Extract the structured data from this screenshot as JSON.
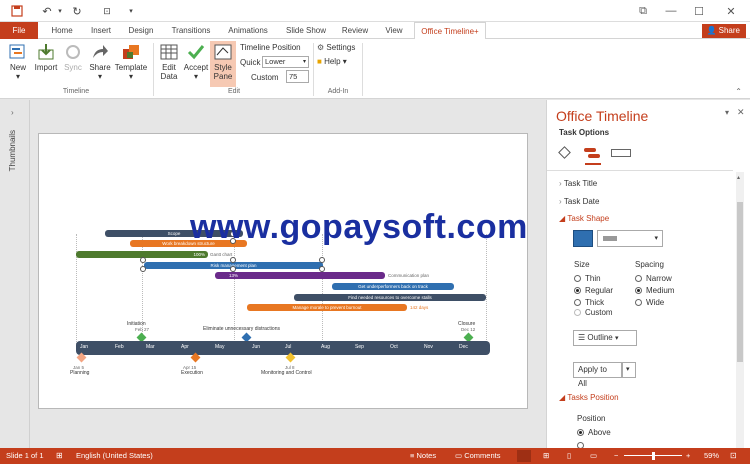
{
  "titlebar": {
    "restore": "⧉",
    "minimize": "—",
    "maximize": "☐",
    "close": "✕"
  },
  "tabs": [
    "File",
    "Home",
    "Insert",
    "Design",
    "Transitions",
    "Animations",
    "Slide Show",
    "Review",
    "View",
    "Office Timeline+"
  ],
  "share_label": "Share",
  "ribbon": {
    "timeline_buttons": [
      "New",
      "Import",
      "Sync",
      "Share",
      "Template"
    ],
    "timeline_group": "Timeline",
    "edit_buttons": [
      "Edit Data",
      "Accept",
      "Style Pane"
    ],
    "timeline_position": "Timeline Position",
    "quick_label": "Quick",
    "quick_value": "Lower",
    "custom_label": "Custom",
    "custom_value": "75",
    "edit_group": "Edit",
    "settings": "Settings",
    "help": "Help",
    "addin_group": "Add-In"
  },
  "rail": {
    "label": "Thumbnails"
  },
  "watermark": "www.gopaysoft.com",
  "timeline": {
    "months": [
      "Jan",
      "Feb",
      "Mar",
      "Apr",
      "May",
      "Jun",
      "Jul",
      "Aug",
      "Sep",
      "Oct",
      "Nov",
      "Dec"
    ],
    "bars": [
      {
        "text": "Scope",
        "color": "#3e4f66"
      },
      {
        "text": "Work breakdown structure",
        "color": "#e87722"
      },
      {
        "text": "Gantt chart",
        "color": "#4e7a2e"
      },
      {
        "text": "Risk management plan",
        "color": "#2f6fb0"
      },
      {
        "text": "",
        "color": "#6a2a8a"
      },
      {
        "text": "Get underperformers back on track",
        "color": "#2f6fb0"
      },
      {
        "text": "Find needed resources to overcome stalls",
        "color": "#3e4f66"
      },
      {
        "text": "Manage morale to prevent burnout",
        "color": "#e87722"
      }
    ],
    "bar_side_labels": {
      "gantt": "Gantt chart",
      "risk_pct": "13%",
      "comm": "Communication plan",
      "morale_days": "142 days",
      "gantt_pct": "100%"
    },
    "above": [
      {
        "name": "Initiation",
        "date": "Feb 27",
        "color": "#4caf50"
      },
      {
        "name": "Eliminate unnecessary distractions",
        "date": "",
        "color": "#2f6fb0"
      },
      {
        "name": "Closure",
        "date": "Dec 12",
        "color": "#4caf50"
      }
    ],
    "below": [
      {
        "name": "Planning",
        "date": "Jan 5",
        "color": "#f4a582"
      },
      {
        "name": "Execution",
        "date": "Apr 15",
        "color": "#e87722"
      },
      {
        "name": "Monitoring and Control",
        "date": "Jul 8",
        "color": "#f2c12e"
      }
    ]
  },
  "pane": {
    "title": "Office Timeline",
    "subtitle": "Task Options",
    "task_title": "Task Title",
    "task_date": "Task Date",
    "task_shape": "Task Shape",
    "size_label": "Size",
    "size_options": [
      "Thin",
      "Regular",
      "Thick",
      "Custom"
    ],
    "spacing_label": "Spacing",
    "spacing_options": [
      "Narrow",
      "Medium",
      "Wide"
    ],
    "outline": "Outline",
    "apply_all": "Apply to All",
    "tasks_position": "Tasks Position",
    "position_label": "Position",
    "position_option": "Above"
  },
  "status": {
    "slide": "Slide 1 of 1",
    "lang": "English (United States)",
    "notes": "Notes",
    "comments": "Comments",
    "zoom": "59%"
  },
  "colors": {
    "accent": "#c43e1c",
    "shape_fill": "#2f6fb0"
  }
}
